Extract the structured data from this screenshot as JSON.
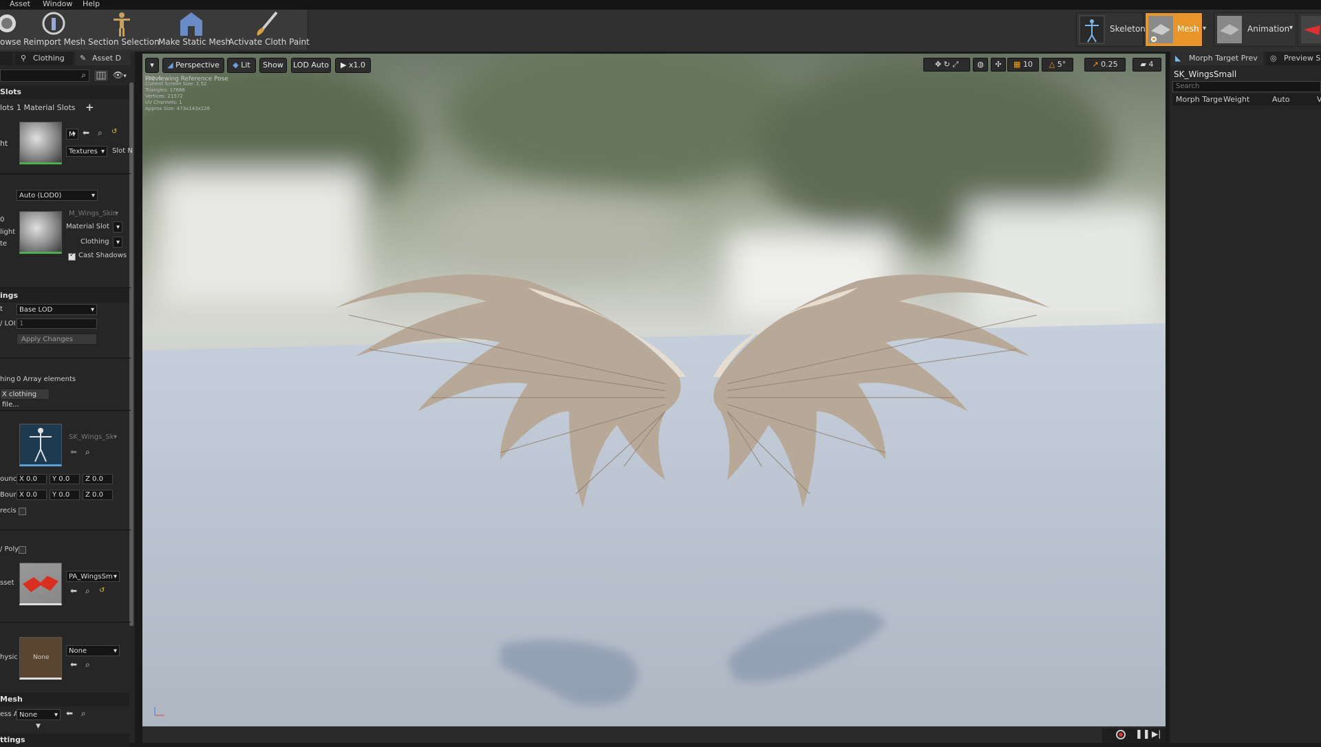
{
  "menu": {
    "items": [
      "Asset",
      "Window",
      "Help"
    ]
  },
  "toolbar": {
    "buttons": [
      "owse",
      "Reimport Mesh",
      "Section Selection",
      "Make Static Mesh",
      "Activate Cloth Paint"
    ],
    "modes": [
      "Skeleton",
      "Mesh",
      "Animation"
    ]
  },
  "left_tabs": [
    "Clothing",
    "Asset D"
  ],
  "material_slots": {
    "header": "Slots",
    "label": "lots",
    "count": "1 Material Slots",
    "textures_dropdown": "Textures",
    "slot_partial": "Slot N",
    "side_label": "ht"
  },
  "lod": {
    "dropdown": "Auto (LOD0)",
    "material_name": "M_Wings_Skin",
    "material_slot_label": "Material Slot",
    "clothing_label": "Clothing",
    "cast_shadows_label": "Cast Shadows",
    "side_labels": [
      "0",
      "light",
      "te"
    ]
  },
  "lod_settings": {
    "header": "ings",
    "base_lod": "Base LOD",
    "lod_value": "1",
    "apply_label": "Apply Changes",
    "side_labels": [
      "t",
      "/ LOI"
    ]
  },
  "clothing": {
    "array_label": "0 Array elements",
    "side_label": "hing",
    "import_button": "X clothing file..."
  },
  "skeleton_asset": {
    "name": "SK_Wings_Sk",
    "bounds_x": "X 0.0",
    "bounds_y": "Y 0.0",
    "bounds_z": "Z 0.0",
    "side_labels": [
      "ounc",
      "Bour",
      "recis"
    ]
  },
  "physics": {
    "poly_label": "/ Poly",
    "asset_label": "sset",
    "physics_asset": "PA_WingsSm",
    "phys_label": "hysic",
    "none_thumb": "None",
    "none_dropdown": "None"
  },
  "mesh_section": {
    "header": "Mesh",
    "label": "ess A",
    "dropdown": "None"
  },
  "settings_header": "ttings",
  "viewport": {
    "perspective": "Perspective",
    "lit": "Lit",
    "show": "Show",
    "lod": "LOD Auto",
    "speed": "x1.0",
    "grid": "10",
    "angle": "5°",
    "scale": "0.25",
    "cam_speed": "4",
    "overlay_title": "Previewing Reference Pose",
    "stats": [
      "LOD: 0",
      "Current Screen Size: 2.52",
      "Triangles: 17686",
      "Vertices: 21572",
      "UV Channels: 1",
      "Approx Size: 473x143x226"
    ]
  },
  "right_panel": {
    "tabs": [
      "Morph Target Prev",
      "Preview S"
    ],
    "asset_name": "SK_WingsSmall",
    "search_placeholder": "Search",
    "columns": [
      "Morph Targe",
      "Weight",
      "Auto",
      "V"
    ]
  },
  "colors": {
    "accent_orange": "#f0a020",
    "record_red": "#e03030"
  }
}
